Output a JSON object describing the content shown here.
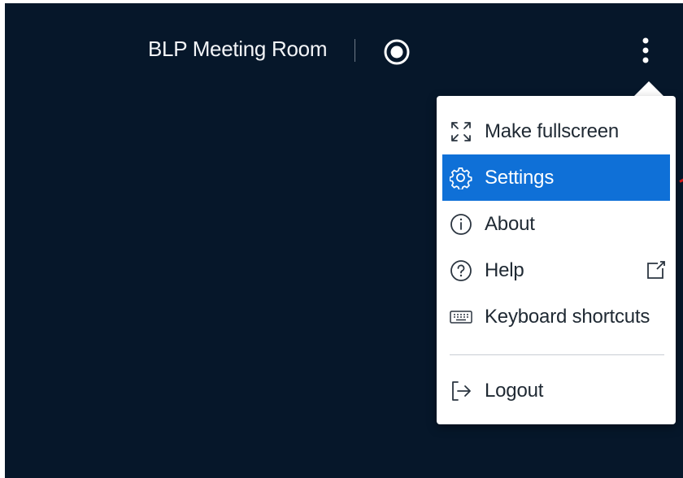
{
  "header": {
    "title": "BLP Meeting Room"
  },
  "menu": {
    "items": [
      {
        "label": "Make fullscreen",
        "icon": "fullscreen-icon"
      },
      {
        "label": "Settings",
        "icon": "gear-icon",
        "active": true
      },
      {
        "label": "About",
        "icon": "info-icon"
      },
      {
        "label": "Help",
        "icon": "help-icon",
        "trailing_icon": "external-link-icon"
      },
      {
        "label": "Keyboard shortcuts",
        "icon": "keyboard-icon"
      },
      {
        "label": "Logout",
        "icon": "logout-icon"
      }
    ]
  },
  "colors": {
    "background": "#06172a",
    "menu_background": "#ffffff",
    "active_item": "#0f70d7",
    "text_light": "#f3f5f8",
    "text_dark": "#1f2933"
  }
}
